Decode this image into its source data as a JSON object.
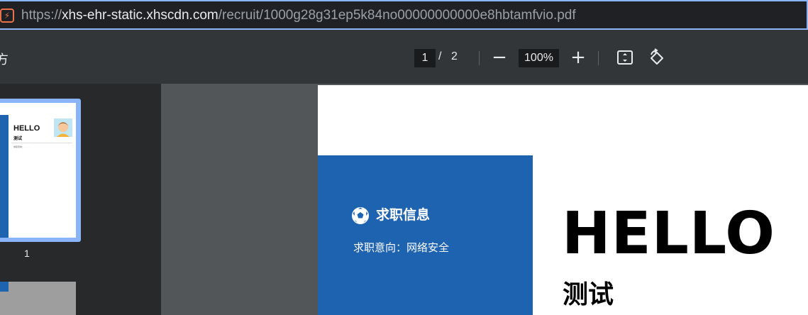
{
  "browser": {
    "url_prefix": "https://",
    "url_host": "xhs-ehr-static.xhscdn.com",
    "url_path": "/recruit/1000g28g31ep5k84no00000000000e8hbtamfvio.pdf",
    "site_icon": "lightning-icon"
  },
  "toolbar": {
    "left_glyph": "方",
    "current_page": "1",
    "page_separator": "/",
    "total_pages": "2",
    "zoom": "100%",
    "zoom_out_symbol": "−",
    "zoom_in_symbol": "+",
    "fit_icon": "fit-to-page-icon",
    "rotate_icon": "rotate-icon"
  },
  "sidebar": {
    "thumbnails": [
      {
        "page_label": "1",
        "hello": "HELLO",
        "subtitle": "测试",
        "small_text": "求职意向：· · · · ·"
      }
    ]
  },
  "document": {
    "section_title": "求职信息",
    "job_intent": "求职意向：网络安全",
    "hello": "HELLO",
    "name": "测试",
    "accent_color": "#1e63b0"
  }
}
